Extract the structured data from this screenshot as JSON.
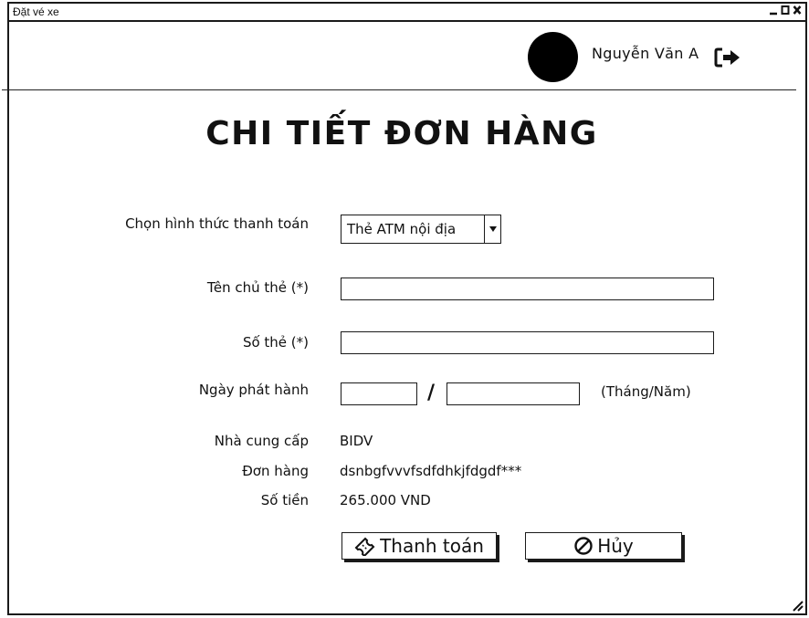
{
  "window": {
    "title": "Đặt vé xe",
    "controls": [
      "minimize-icon",
      "maximize-icon",
      "close-icon"
    ]
  },
  "header": {
    "username": "Nguyễn Văn A",
    "avatar_icon": "avatar",
    "logout_icon": "logout-icon"
  },
  "page": {
    "title": "CHI TIẾT ĐƠN HÀNG"
  },
  "form": {
    "payment_method": {
      "label": "Chọn hình thức thanh toán",
      "value": "Thẻ ATM nội địa"
    },
    "card_holder": {
      "label": "Tên chủ thẻ (*)",
      "value": ""
    },
    "card_number": {
      "label": "Số thẻ (*)",
      "value": ""
    },
    "issue_date": {
      "label": "Ngày phát hành",
      "month": "",
      "year": "",
      "separator": "/",
      "hint": "(Tháng/Năm)"
    },
    "provider": {
      "label": "Nhà cung cấp",
      "value": "BIDV"
    },
    "order": {
      "label": "Đơn hàng",
      "value": "dsnbgfvvvfsdfdhkjfdgdf***"
    },
    "amount": {
      "label": "Số tiền",
      "value": "265.000 VND"
    }
  },
  "actions": {
    "pay_label": "Thanh toán",
    "pay_icon": "ticket-icon",
    "cancel_label": "Hủy",
    "cancel_icon": "cancel-icon"
  }
}
